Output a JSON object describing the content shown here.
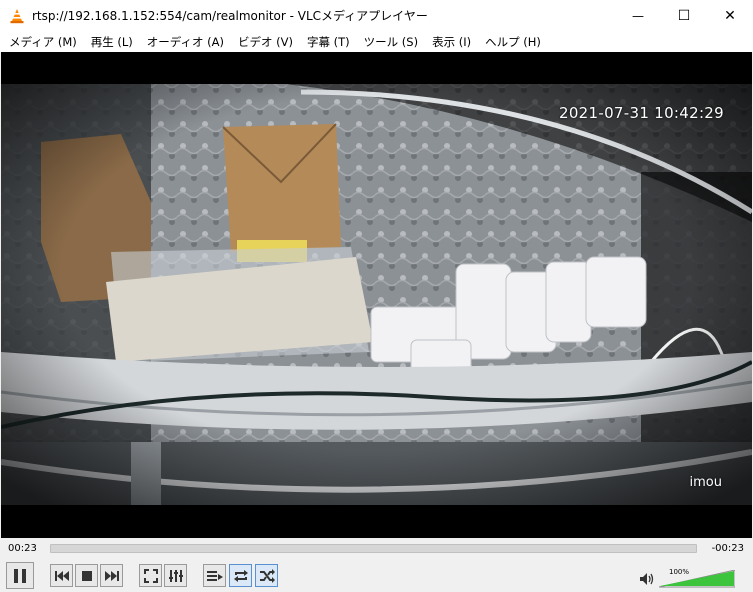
{
  "window": {
    "title": "rtsp://192.168.1.152:554/cam/realmonitor - VLCメディアプレイヤー",
    "minimize": "—",
    "maximize": "☐",
    "close": "✕"
  },
  "menu": {
    "items": [
      {
        "label": "メディア (M)"
      },
      {
        "label": "再生 (L)"
      },
      {
        "label": "オーディオ (A)"
      },
      {
        "label": "ビデオ (V)"
      },
      {
        "label": "字幕 (T)"
      },
      {
        "label": "ツール (S)"
      },
      {
        "label": "表示 (I)"
      },
      {
        "label": "ヘルプ (H)"
      }
    ]
  },
  "video": {
    "timestamp": "2021-07-31 10:42:29",
    "watermark": "imou"
  },
  "seek": {
    "elapsed": "00:23",
    "remaining": "-00:23"
  },
  "controls": {
    "volume_percent": "100%",
    "volume_level": 1.0,
    "icons": [
      "pause-icon",
      "previous-icon",
      "stop-icon",
      "next-icon",
      "fullscreen-icon",
      "extended-settings-icon",
      "playlist-icon",
      "loop-icon",
      "shuffle-icon",
      "speaker-icon"
    ]
  },
  "colors": {
    "accent_blue": "#5a8fd0",
    "volume_green": "#3cc43c",
    "vlc_orange": "#ff8800"
  }
}
